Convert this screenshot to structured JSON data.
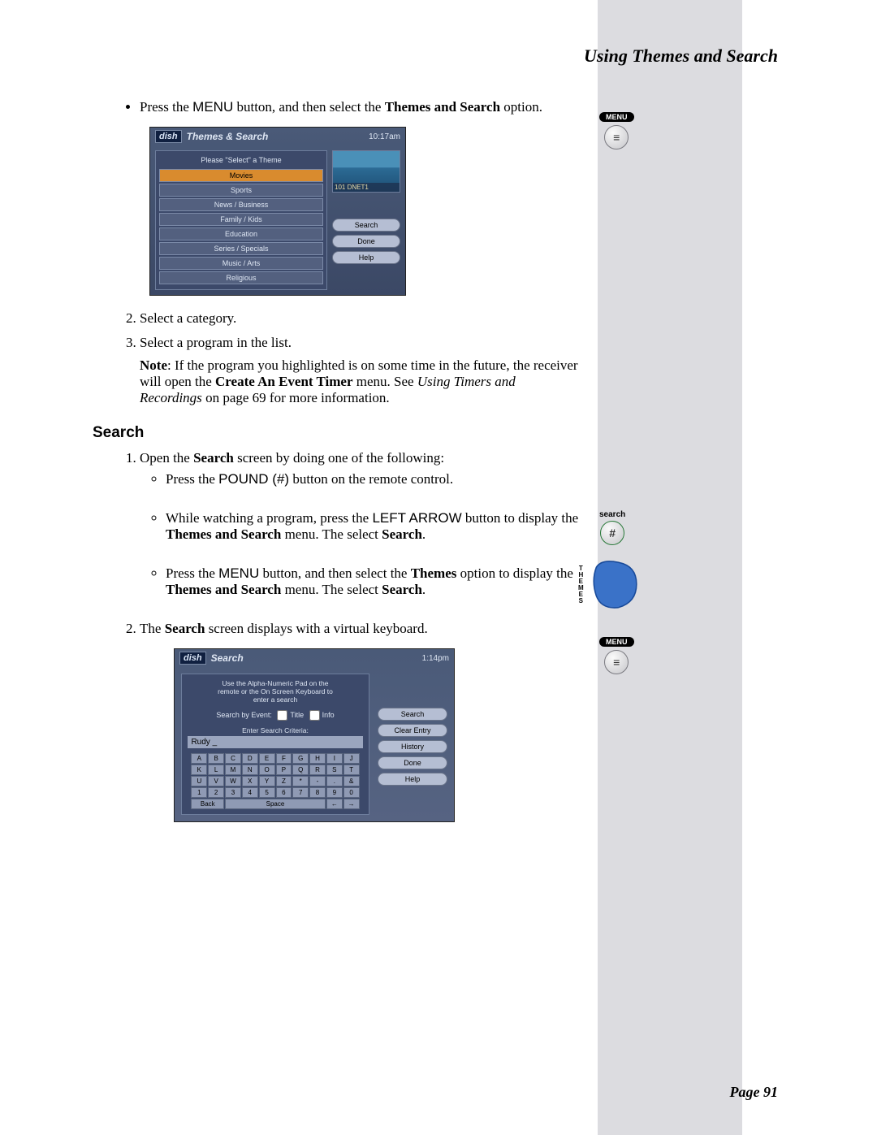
{
  "header": {
    "title": "Using Themes and Search"
  },
  "footer": {
    "page": "Page 91"
  },
  "intro_bullet": {
    "pre": "Press the ",
    "menu": "MENU",
    "mid": " button, and then select the ",
    "bold1": "Themes and Search",
    "post": " option."
  },
  "shot1": {
    "logo": "dish",
    "title": "Themes & Search",
    "time": "10:17am",
    "caption": "Please \"Select\" a Theme",
    "items": [
      "Movies",
      "Sports",
      "News / Business",
      "Family / Kids",
      "Education",
      "Series / Specials",
      "Music / Arts",
      "Religious"
    ],
    "channel": "101 DNET1",
    "buttons": {
      "search": "Search",
      "done": "Done",
      "help": "Help"
    }
  },
  "step2": "Select a category.",
  "step3": "Select a program in the list.",
  "note": {
    "label": "Note",
    "t1": ": If the program you highlighted is on some time in the future, the receiver will open the ",
    "b1": "Create An Event Timer",
    "t2": " menu. See ",
    "i1": "Using Timers and Recordings",
    "t3": " on page 69 for more information."
  },
  "search_heading": "Search",
  "search_step1": {
    "pre": "Open the ",
    "b1": "Search",
    "post": " screen by doing one of the following:"
  },
  "sb1": {
    "pre": "Press the ",
    "k": "POUND (#)",
    "post": " button on the remote control."
  },
  "sb2": {
    "t1": "While watching a program, press the ",
    "k": "LEFT ARROW",
    "t2": " button to display the ",
    "b1": "Themes and Search",
    "t3": " menu. The select ",
    "b2": "Search",
    "t4": "."
  },
  "sb3": {
    "t1": "Press the ",
    "k": "MENU",
    "t2": " button, and then select the ",
    "b1": "Themes",
    "t3": " option to display the ",
    "b2": "Themes and Search",
    "t4": " menu. The select ",
    "b3": "Search",
    "t5": "."
  },
  "search_step2": {
    "t1": "The ",
    "b1": "Search",
    "t2": " screen displays with a virtual keyboard."
  },
  "shot2": {
    "logo": "dish",
    "title": "Search",
    "time": "1:14pm",
    "msg_l1": "Use the Alpha-Numeric Pad on the",
    "msg_l2": "remote or the On Screen Keyboard to",
    "msg_l3": "enter a search",
    "by_event": "Search by Event:",
    "title_chk": "Title",
    "info_chk": "Info",
    "criteria": "Enter Search Criteria:",
    "input": "Rudy _",
    "keys_row1": [
      "A",
      "B",
      "C",
      "D",
      "E",
      "F",
      "G",
      "H",
      "I",
      "J"
    ],
    "keys_row2": [
      "K",
      "L",
      "M",
      "N",
      "O",
      "P",
      "Q",
      "R",
      "S",
      "T"
    ],
    "keys_row3": [
      "U",
      "V",
      "W",
      "X",
      "Y",
      "Z",
      "*",
      "-",
      ".",
      "&"
    ],
    "keys_row4": [
      "1",
      "2",
      "3",
      "4",
      "5",
      "6",
      "7",
      "8",
      "9",
      "0"
    ],
    "back": "Back",
    "space": "Space",
    "arr_l": "←",
    "arr_r": "→",
    "buttons": {
      "search": "Search",
      "clear": "Clear Entry",
      "history": "History",
      "done": "Done",
      "help": "Help"
    }
  },
  "margin": {
    "menu": "MENU",
    "search": "search",
    "hash": "#",
    "themes": "THEMES",
    "bars": "≡"
  }
}
